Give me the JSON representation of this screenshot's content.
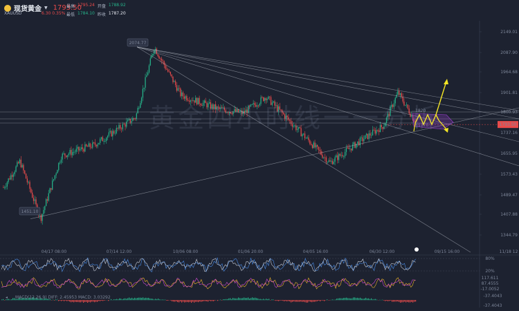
{
  "header": {
    "name": "现货黄金",
    "code": "XAUUSD",
    "price": "1793.50",
    "change": "6.30",
    "change_pct": "0.35%",
    "high_label": "最高",
    "high": "1795.24",
    "open_label": "开盘",
    "open": "1788.92",
    "low_label": "最低",
    "low": "1784.10",
    "prev_label": "昨收",
    "prev": "1787.20"
  },
  "watermark": "黄金四小时线一一分析",
  "icons": {
    "symbol": "gold-coin-icon",
    "dropdown": "caret-down-icon",
    "collapse": "collapse-arrow-icon",
    "marker": "realtime-marker-icon"
  },
  "colors": {
    "up": "#26b38a",
    "down": "#e84b4b",
    "background": "#1d2230",
    "arrow": "#f5e625",
    "box": "#9b3fd0"
  },
  "chart_data": {
    "type": "candlestick",
    "y_ticks": [
      "2149.01",
      "2087.90",
      "1964.68",
      "1901.81",
      "1800.93",
      "1737.16",
      "1655.95",
      "1573.43",
      "1489.47",
      "1407.88",
      "1344.79"
    ],
    "x_ticks": [
      "04/17 08:00",
      "07/14 12:00",
      "10/06 08:00",
      "01/06 20:00",
      "04/05 16:00",
      "06/30 12:00",
      "09/15 16:00",
      "11/18 12"
    ],
    "ylim": [
      1330,
      2170
    ],
    "annotations": [
      {
        "text": "2074.77",
        "x": "07/14 12:00",
        "y": 2074.77
      },
      {
        "text": "1451.10",
        "x": "04/17 08:00",
        "y": 1451.1
      },
      {
        "text": "1820",
        "y": 1820
      },
      {
        "text": "1770",
        "y": 1770
      }
    ],
    "current_price": 1793.5,
    "pivots": [
      {
        "x": 0.0,
        "y": 1565
      },
      {
        "x": 0.04,
        "y": 1660
      },
      {
        "x": 0.09,
        "y": 1451.1
      },
      {
        "x": 0.14,
        "y": 1680
      },
      {
        "x": 0.22,
        "y": 1720
      },
      {
        "x": 0.32,
        "y": 1820
      },
      {
        "x": 0.365,
        "y": 2074.77
      },
      {
        "x": 0.43,
        "y": 1900
      },
      {
        "x": 0.52,
        "y": 1850
      },
      {
        "x": 0.58,
        "y": 1835
      },
      {
        "x": 0.635,
        "y": 1895
      },
      {
        "x": 0.7,
        "y": 1795
      },
      {
        "x": 0.79,
        "y": 1655
      },
      {
        "x": 0.86,
        "y": 1730
      },
      {
        "x": 0.92,
        "y": 1790
      },
      {
        "x": 0.955,
        "y": 1910
      },
      {
        "x": 1.0,
        "y": 1795
      }
    ]
  },
  "indicators": {
    "kdj": {
      "levels": [
        "80%",
        "20%"
      ]
    },
    "stoch": {
      "levels": [
        "117.611",
        "87.4555",
        "-17.0052"
      ]
    },
    "macd": {
      "label": "MACD(12,26,9)",
      "values": "DIFF: 2.45953   MACD: 3.03292",
      "levels": [
        "-37.4043"
      ]
    }
  }
}
